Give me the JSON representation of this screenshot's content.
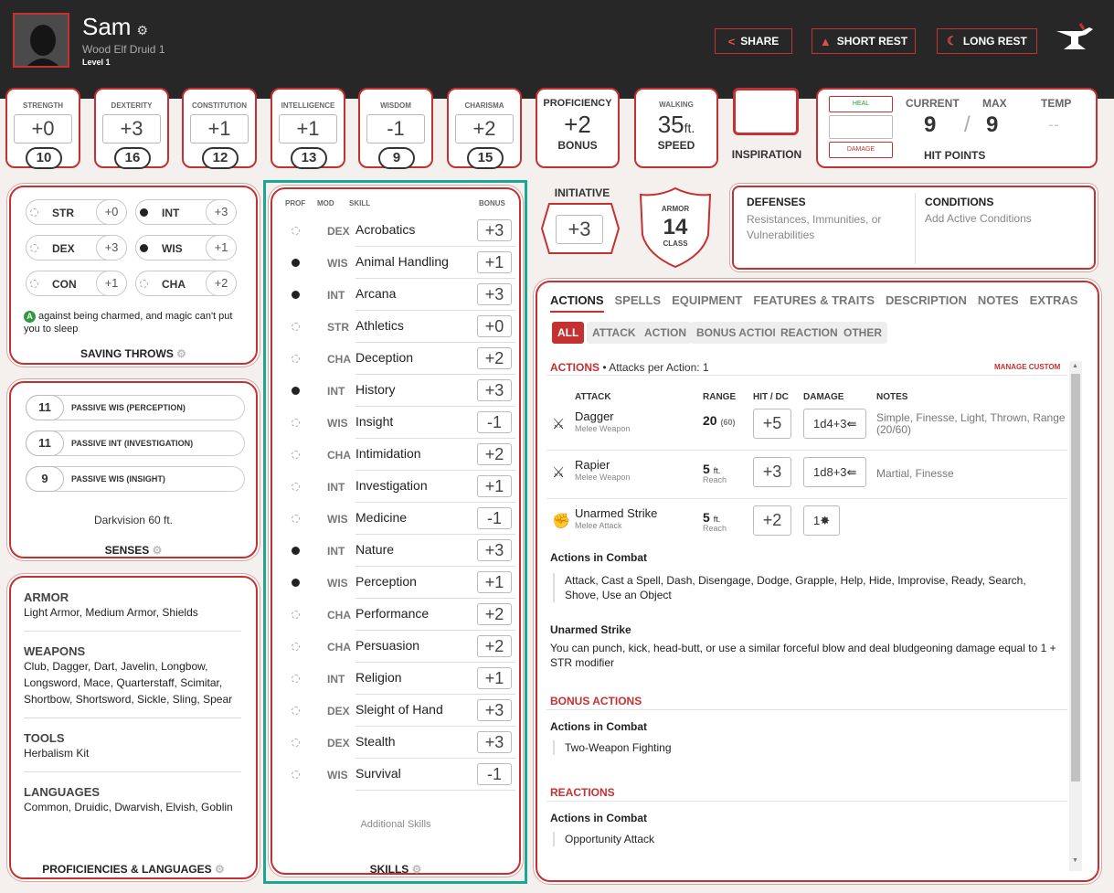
{
  "header": {
    "name": "Sam",
    "race_class": "Wood Elf  Druid 1",
    "level": "Level 1",
    "buttons": {
      "share": "SHARE",
      "short_rest": "SHORT REST",
      "long_rest": "LONG REST"
    }
  },
  "abilities": [
    {
      "label": "STRENGTH",
      "mod": "+0",
      "score": "10"
    },
    {
      "label": "DEXTERITY",
      "mod": "+3",
      "score": "16"
    },
    {
      "label": "CONSTITUTION",
      "mod": "+1",
      "score": "12"
    },
    {
      "label": "INTELLIGENCE",
      "mod": "+1",
      "score": "13"
    },
    {
      "label": "WISDOM",
      "mod": "-1",
      "score": "9"
    },
    {
      "label": "CHARISMA",
      "mod": "+2",
      "score": "15"
    }
  ],
  "proficiency": {
    "top": "PROFICIENCY",
    "value": "+2",
    "bottom": "BONUS"
  },
  "speed": {
    "top": "WALKING",
    "value": "35",
    "unit": "ft.",
    "bottom": "SPEED"
  },
  "inspiration": {
    "label": "INSPIRATION"
  },
  "hp": {
    "heal": "HEAL",
    "damage": "DAMAGE",
    "current_label": "CURRENT",
    "max_label": "MAX",
    "temp_label": "TEMP",
    "current": "9",
    "sep": "/",
    "max": "9",
    "temp": "--",
    "title": "HIT POINTS"
  },
  "saving_throws": {
    "rows": [
      {
        "name": "STR",
        "mod": "+0",
        "prof": false
      },
      {
        "name": "INT",
        "mod": "+3",
        "prof": true
      },
      {
        "name": "DEX",
        "mod": "+3",
        "prof": false
      },
      {
        "name": "WIS",
        "mod": "+1",
        "prof": true
      },
      {
        "name": "CON",
        "mod": "+1",
        "prof": false
      },
      {
        "name": "CHA",
        "mod": "+2",
        "prof": false
      }
    ],
    "adv_badge": "A",
    "note": "against being charmed, and magic can't put you to sleep",
    "title": "SAVING THROWS"
  },
  "senses": {
    "rows": [
      {
        "value": "11",
        "label": "PASSIVE WIS (PERCEPTION)"
      },
      {
        "value": "11",
        "label": "PASSIVE INT (INVESTIGATION)"
      },
      {
        "value": "9",
        "label": "PASSIVE WIS (INSIGHT)"
      }
    ],
    "darkvision": "Darkvision 60 ft.",
    "title": "SENSES"
  },
  "proficiencies": {
    "armor_h": "ARMOR",
    "armor": "Light Armor, Medium Armor, Shields",
    "weapons_h": "WEAPONS",
    "weapons": "Club, Dagger, Dart, Javelin, Longbow, Longsword, Mace, Quarterstaff, Scimitar, Shortbow, Shortsword, Sickle, Sling, Spear",
    "tools_h": "TOOLS",
    "tools": "Herbalism Kit",
    "languages_h": "LANGUAGES",
    "languages": "Common, Druidic, Dwarvish, Elvish, Goblin",
    "title": "PROFICIENCIES & LANGUAGES"
  },
  "skills": {
    "headers": {
      "prof": "PROF",
      "mod": "MOD",
      "skill": "SKILL",
      "bonus": "BONUS"
    },
    "rows": [
      {
        "mod": "DEX",
        "name": "Acrobatics",
        "bonus": "+3",
        "prof": false
      },
      {
        "mod": "WIS",
        "name": "Animal Handling",
        "bonus": "+1",
        "prof": true
      },
      {
        "mod": "INT",
        "name": "Arcana",
        "bonus": "+3",
        "prof": true
      },
      {
        "mod": "STR",
        "name": "Athletics",
        "bonus": "+0",
        "prof": false
      },
      {
        "mod": "CHA",
        "name": "Deception",
        "bonus": "+2",
        "prof": false
      },
      {
        "mod": "INT",
        "name": "History",
        "bonus": "+3",
        "prof": true
      },
      {
        "mod": "WIS",
        "name": "Insight",
        "bonus": "-1",
        "prof": false
      },
      {
        "mod": "CHA",
        "name": "Intimidation",
        "bonus": "+2",
        "prof": false
      },
      {
        "mod": "INT",
        "name": "Investigation",
        "bonus": "+1",
        "prof": false
      },
      {
        "mod": "WIS",
        "name": "Medicine",
        "bonus": "-1",
        "prof": false
      },
      {
        "mod": "INT",
        "name": "Nature",
        "bonus": "+3",
        "prof": true
      },
      {
        "mod": "WIS",
        "name": "Perception",
        "bonus": "+1",
        "prof": true
      },
      {
        "mod": "CHA",
        "name": "Performance",
        "bonus": "+2",
        "prof": false
      },
      {
        "mod": "CHA",
        "name": "Persuasion",
        "bonus": "+2",
        "prof": false
      },
      {
        "mod": "INT",
        "name": "Religion",
        "bonus": "+1",
        "prof": false
      },
      {
        "mod": "DEX",
        "name": "Sleight of Hand",
        "bonus": "+3",
        "prof": false
      },
      {
        "mod": "DEX",
        "name": "Stealth",
        "bonus": "+3",
        "prof": false
      },
      {
        "mod": "WIS",
        "name": "Survival",
        "bonus": "-1",
        "prof": false
      }
    ],
    "additional": "Additional Skills",
    "title": "SKILLS"
  },
  "initiative": {
    "label": "INITIATIVE",
    "value": "+3"
  },
  "armor_class": {
    "top": "ARMOR",
    "value": "14",
    "bottom": "CLASS"
  },
  "defenses": {
    "title": "DEFENSES",
    "text": "Resistances, Immunities, or Vulnerabilities"
  },
  "conditions": {
    "title": "CONDITIONS",
    "text": "Add Active Conditions"
  },
  "actions_panel": {
    "tabs": [
      "ACTIONS",
      "SPELLS",
      "EQUIPMENT",
      "FEATURES & TRAITS",
      "DESCRIPTION",
      "NOTES",
      "EXTRAS"
    ],
    "filters": [
      "ALL",
      "ATTACK",
      "ACTION",
      "BONUS ACTION",
      "REACTION",
      "OTHER"
    ],
    "actions_h": "ACTIONS",
    "attacks_per": " • Attacks per Action: 1",
    "manage": "MANAGE CUSTOM",
    "cols": {
      "attack": "ATTACK",
      "range": "RANGE",
      "hit": "HIT / DC",
      "damage": "DAMAGE",
      "notes": "NOTES"
    },
    "attacks": [
      {
        "name": "Dagger",
        "sub": "Melee Weapon",
        "range": "20",
        "range_sub": "(60)",
        "hit": "+5",
        "damage": "1d4+3",
        "notes": "Simple, Finesse, Light, Thrown, Range (20/60)"
      },
      {
        "name": "Rapier",
        "sub": "Melee Weapon",
        "range": "5",
        "range_unit": "ft.",
        "range_sub": "Reach",
        "hit": "+3",
        "damage": "1d8+3",
        "notes": "Martial, Finesse"
      },
      {
        "name": "Unarmed Strike",
        "sub": "Melee Attack",
        "range": "5",
        "range_unit": "ft.",
        "range_sub": "Reach",
        "hit": "+2",
        "damage": "1",
        "notes": ""
      }
    ],
    "combat_h": "Actions in Combat",
    "combat_text": "Attack, Cast a Spell, Dash, Disengage, Dodge, Grapple, Help, Hide, Improvise, Ready, Search, Shove, Use an Object",
    "unarmed_h": "Unarmed Strike",
    "unarmed_text": "You can punch, kick, head-butt, or use a similar forceful blow and deal bludgeoning damage equal to 1 + STR modifier",
    "bonus_h": "BONUS ACTIONS",
    "bonus_sub": "Actions in Combat",
    "bonus_text": "Two-Weapon Fighting",
    "reactions_h": "REACTIONS",
    "reactions_sub": "Actions in Combat",
    "reactions_text": "Opportunity Attack"
  },
  "colors": {
    "accent": "#c53131",
    "header_bg": "#272727",
    "skills_highlight": "#1aa893"
  }
}
